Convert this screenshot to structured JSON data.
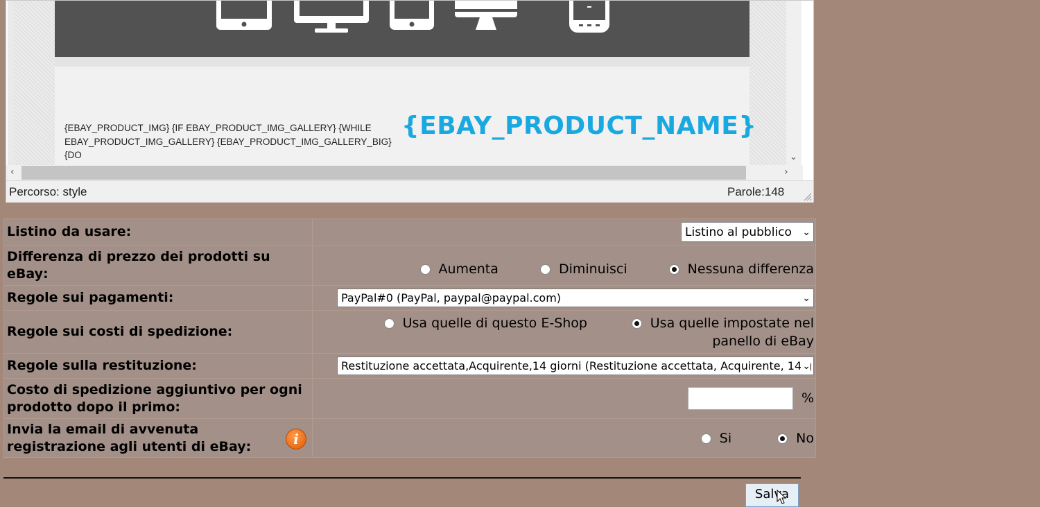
{
  "editor": {
    "template_tags_text": "{EBAY_PRODUCT_IMG} {IF EBAY_PRODUCT_IMG_GALLERY} {WHILE EBAY_PRODUCT_IMG_GALLERY} {EBAY_PRODUCT_IMG_GALLERY_BIG} {DO",
    "product_name_placeholder": "{EBAY_PRODUCT_NAME}",
    "path_label": "Percorso: style",
    "word_count": "Parole:148",
    "device_icons": [
      "tablet-icon",
      "monitor-icon",
      "phone-icon",
      "desktop-icon",
      "mobile-icon"
    ],
    "accent_color": "#1aa8e0"
  },
  "settings": {
    "price_list": {
      "label": "Listino da usare:",
      "selected": "Listino al pubblico"
    },
    "price_difference": {
      "label": "Differenza di prezzo dei prodotti su eBay:",
      "options": [
        "Aumenta",
        "Diminuisci",
        "Nessuna differenza"
      ],
      "selected": "Nessuna differenza"
    },
    "payments": {
      "label": "Regole sui pagamenti:",
      "selected": "PayPal#0 (PayPal, paypal@paypal.com)"
    },
    "shipping_costs": {
      "label": "Regole sui costi di spedizione:",
      "option_shop": "Usa quelle di questo E-Shop",
      "option_ebay_line1": "Usa quelle impostate nel",
      "option_ebay_line2": "panello di eBay",
      "selected": "ebay"
    },
    "returns": {
      "label": "Regole sulla restituzione:",
      "selected": "Restituzione accettata,Acquirente,14 giorni (Restituzione accettata, Acquirente, 14 g"
    },
    "extra_shipping": {
      "label": "Costo di spedizione aggiuntivo per ogni prodotto dopo il primo:",
      "value": "",
      "unit": "%"
    },
    "send_email": {
      "label": "Invia la email di avvenuta registrazione agli utenti di eBay:",
      "option_yes": "Si",
      "option_no": "No",
      "selected": "No"
    }
  },
  "save_label": "Salva"
}
